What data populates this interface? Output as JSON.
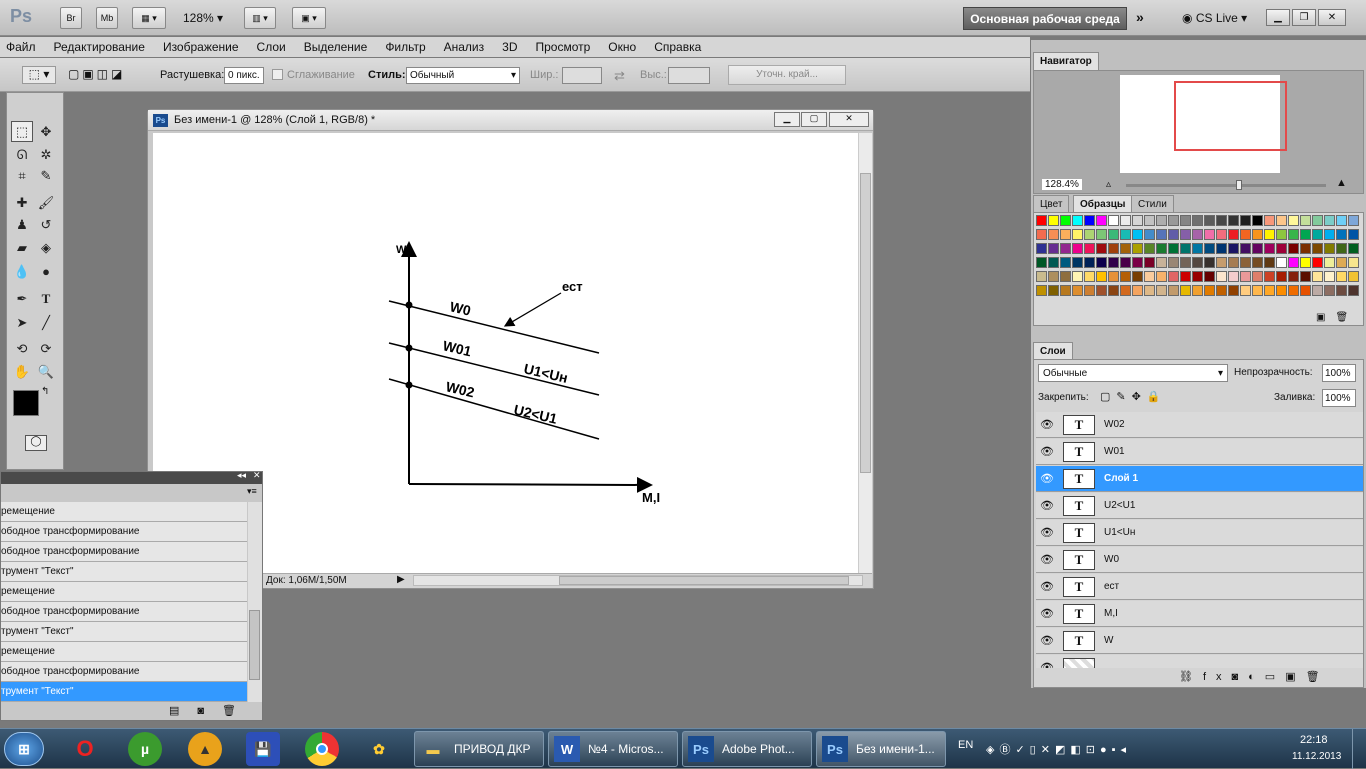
{
  "app": {
    "logo": "Ps",
    "bridge_label": "Br",
    "minibridge_label": "Mb",
    "zoom": "128%",
    "workspace": "Основная рабочая среда",
    "cslive": "CS Live"
  },
  "menu": [
    "Файл",
    "Редактирование",
    "Изображение",
    "Слои",
    "Выделение",
    "Фильтр",
    "Анализ",
    "3D",
    "Просмотр",
    "Окно",
    "Справка"
  ],
  "options": {
    "feather_label": "Растушевка:",
    "feather_value": "0 пикс.",
    "antialias_label": "Сглаживание",
    "style_label": "Стиль:",
    "style_value": "Обычный",
    "width_label": "Шир.:",
    "height_label": "Выс.:",
    "refine_label": "Уточн. край..."
  },
  "document": {
    "icon": "Ps",
    "title": "Без имени-1 @ 128% (Слой 1, RGB/8) *",
    "status": "Док: 1,06M/1,50M"
  },
  "drawing": {
    "y_axis": "W",
    "x_axis": "M,I",
    "labels": [
      "W0",
      "W01",
      "W02",
      "ест",
      "U1<Uн",
      "U2<U1"
    ]
  },
  "history": {
    "items": [
      "ремещение",
      "ободное трансформирование",
      "ободное трансформирование",
      "трумент \"Текст\"",
      "ремещение",
      "ободное трансформирование",
      "трумент \"Текст\"",
      "ремещение",
      "ободное трансформирование",
      "трумент \"Текст\""
    ],
    "selected_index": 9
  },
  "navigator": {
    "tab": "Навигатор",
    "zoom": "128.4%"
  },
  "swatches": {
    "tabs": [
      "Цвет",
      "Образцы",
      "Стили"
    ],
    "active_tab": "Образцы"
  },
  "layers": {
    "tab": "Слои",
    "blend_mode": "Обычные",
    "opacity_label": "Непрозрачность:",
    "opacity_value": "100%",
    "lock_label": "Закрепить:",
    "fill_label": "Заливка:",
    "fill_value": "100%",
    "items": [
      {
        "name": "W02",
        "selected": false
      },
      {
        "name": "W01",
        "selected": false
      },
      {
        "name": "Слой 1",
        "selected": true
      },
      {
        "name": "U2<U1",
        "selected": false
      },
      {
        "name": "U1<Uн",
        "selected": false
      },
      {
        "name": "W0",
        "selected": false
      },
      {
        "name": "ест",
        "selected": false
      },
      {
        "name": "M,I",
        "selected": false
      },
      {
        "name": "W",
        "selected": false
      }
    ]
  },
  "taskbar": {
    "tasks": [
      "ПРИВОД ДКР",
      "№4 - Micros...",
      "Adobe Phot...",
      "Без имени-1..."
    ],
    "lang": "EN",
    "time": "22:18",
    "date": "11.12.2013"
  },
  "colors": {
    "selection": "#3399ff",
    "foreground": "#000000",
    "background": "#ffffff"
  }
}
